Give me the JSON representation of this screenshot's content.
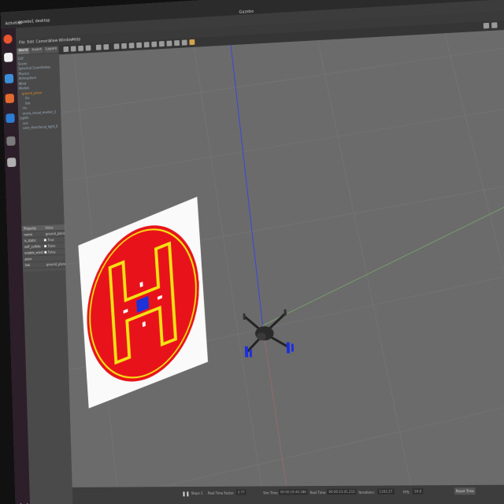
{
  "topbar": {
    "activities": "Activities",
    "terminal": "gazebo1 desktop",
    "window_title": "Gazebo"
  },
  "dock": {
    "icons": [
      "browser-icon",
      "files-icon",
      "editor-icon",
      "vscode-icon",
      "tool-icon",
      "usb-icon"
    ],
    "colors": [
      "#e9542c",
      "#3b8fd9",
      "#e36a2e",
      "#2b7cd3",
      "#7a7a7a",
      "#b0b0b0"
    ]
  },
  "menu": {
    "items": [
      "File",
      "Edit",
      "Camera",
      "View",
      "Window",
      "Help"
    ]
  },
  "leftpanel": {
    "tabs": [
      "World",
      "Insert",
      "Layers"
    ],
    "tree": [
      {
        "label": "GUI",
        "level": 0
      },
      {
        "label": "Scene",
        "level": 0
      },
      {
        "label": "Spherical Coordinates",
        "level": 0
      },
      {
        "label": "Physics",
        "level": 0
      },
      {
        "label": "Atmosphere",
        "level": 0
      },
      {
        "label": "Wind",
        "level": 0
      },
      {
        "label": "Models",
        "level": 0
      },
      {
        "label": "ground_plane",
        "level": 1,
        "highlight": true
      },
      {
        "label": "iris",
        "level": 2
      },
      {
        "label": "link",
        "level": 2
      },
      {
        "label": "iris",
        "level": 1
      },
      {
        "label": "aruco_visual_marker_1",
        "level": 1
      },
      {
        "label": "Lights",
        "level": 0
      },
      {
        "label": "sun",
        "level": 1
      },
      {
        "label": "user_directional_light_0",
        "level": 1
      }
    ],
    "properties": {
      "headers": [
        "Property",
        "Value"
      ],
      "rows": [
        {
          "key": "name",
          "value": "ground_plane",
          "checkbox": false
        },
        {
          "key": "is_static",
          "value": "True",
          "checkbox": true
        },
        {
          "key": "self_collide",
          "value": "False",
          "checkbox": true
        },
        {
          "key": "enable_wind",
          "value": "False",
          "checkbox": true
        },
        {
          "key": "pose",
          "value": "",
          "checkbox": false
        },
        {
          "key": "link",
          "value": "ground_plane::link",
          "checkbox": false
        }
      ]
    }
  },
  "statusbar": {
    "steps_label": "Steps:",
    "steps_value": "1",
    "real_time_factor_label": "Real Time Factor:",
    "real_time_factor_value": "0.77",
    "sim_time_label": "Sim Time:",
    "sim_time_value": "00:00:19:44.388",
    "real_time_label": "Real Time:",
    "real_time_value": "00:00:23:41.215",
    "iterations_label": "Iterations:",
    "iterations_value": "1163.27",
    "fps_label": "FPS:",
    "fps_value": "59.8",
    "reset_label": "Reset Time"
  },
  "scene": {
    "pad_color": "#e8131a",
    "pad_ring": "#f4e214",
    "pad_letter": "H",
    "marker_color": "#1d32d8",
    "rotor_color": "#1a2fe0",
    "axis_z_color": "#2b3cff",
    "axis_x_color": "#7fae6e"
  }
}
